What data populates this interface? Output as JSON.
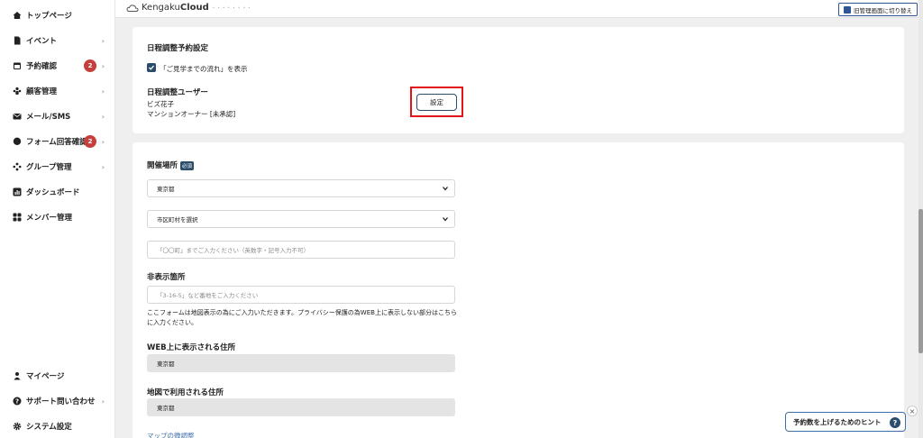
{
  "header": {
    "logo_prefix": "Kengaku",
    "logo_bold": "Cloud",
    "logo_tagline": "• • • • • • • •",
    "switch_label": "旧管理画面に切り替え"
  },
  "sidebar": {
    "items": [
      {
        "label": "トップページ",
        "icon": "home-icon"
      },
      {
        "label": "イベント",
        "icon": "document-icon",
        "chevron": "›"
      },
      {
        "label": "予約確認",
        "icon": "calendar-icon",
        "badge": "2",
        "chevron": "›"
      },
      {
        "label": "顧客管理",
        "icon": "users-icon",
        "chevron": "›"
      },
      {
        "label": "メール/SMS",
        "icon": "mail-icon",
        "chevron": "›"
      },
      {
        "label": "フォーム回答確認",
        "icon": "chat-icon",
        "badge": "2",
        "chevron": "›"
      },
      {
        "label": "グループ管理",
        "icon": "group-icon",
        "chevron": "›"
      },
      {
        "label": "ダッシュボード",
        "icon": "chart-icon"
      },
      {
        "label": "メンバー管理",
        "icon": "grid-icon"
      }
    ],
    "bottom_items": [
      {
        "label": "マイページ",
        "icon": "person-icon"
      },
      {
        "label": "サポート問い合わせ",
        "icon": "help-icon",
        "chevron": "›"
      },
      {
        "label": "システム設定",
        "icon": "gear-icon"
      }
    ]
  },
  "schedule": {
    "title": "日程調整予約設定",
    "checkbox_label": "「ご見学までの流れ」を表示",
    "checkbox_checked": true,
    "user_title": "日程調整ユーザー",
    "user_name": "ビズ花子",
    "user_role": "マンションオーナー [未承認]",
    "set_button": "設定"
  },
  "venue": {
    "title": "開催場所",
    "required_badge": "必須",
    "prefecture_value": "東京都",
    "city_value": "市区町村を選択",
    "town_placeholder": "「〇〇町」までご入力ください（英数字・記号入力不可）",
    "hidden_title": "非表示箇所",
    "hidden_placeholder": "「3-16-5」など番地をご入力ください",
    "help_text": "ここフォームは地図表示の為にご入力いただきます。プライバシー保護の為WEB上に表示しない部分はこちらに入力ください。",
    "web_address_title": "WEB上に表示される住所",
    "web_address_value": "東京都",
    "map_address_title": "地図で利用される住所",
    "map_address_value": "東京都",
    "map_adjust_link": "マップの微調整"
  },
  "hint": {
    "label": "予約数を上げるためのヒント",
    "icon": "question-icon",
    "close": "×"
  },
  "colors": {
    "accent": "#2b4c6b",
    "badge": "#c5403d",
    "highlight": "#e2141a",
    "link": "#3d6ea8"
  }
}
